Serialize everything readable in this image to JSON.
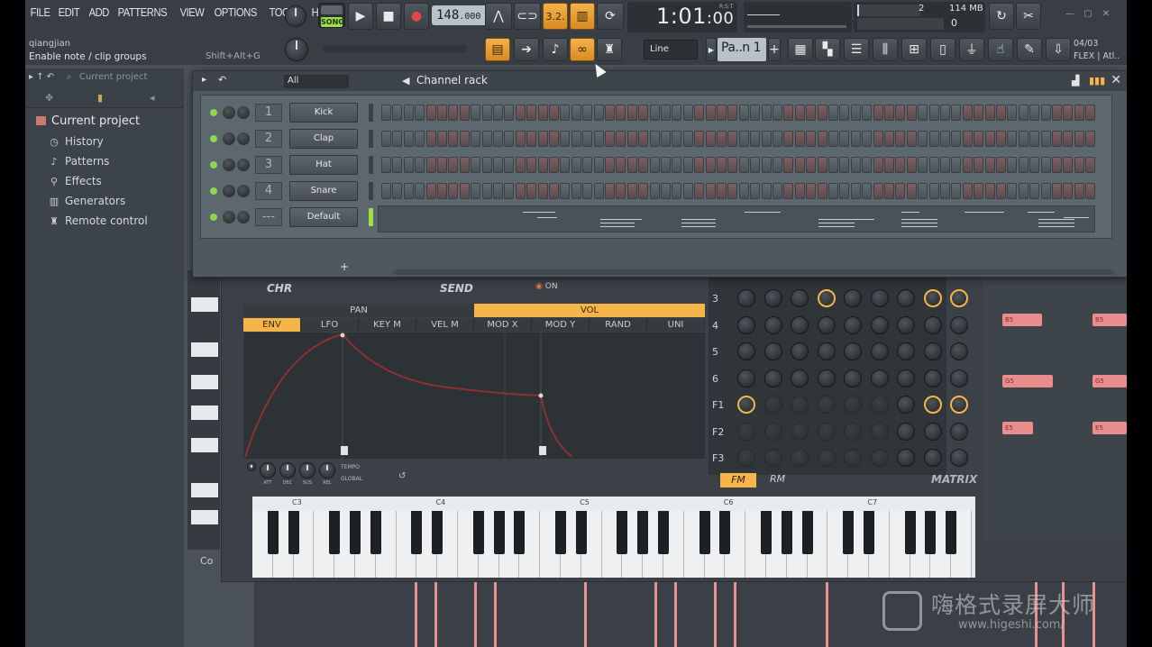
{
  "menu": {
    "items": [
      "FILE",
      "EDIT",
      "ADD",
      "PATTERNS",
      "VIEW",
      "OPTIONS",
      "TOOLS",
      "HELP"
    ]
  },
  "hint_bar": {
    "user": "qiangjian",
    "text": "Enable note / clip groups",
    "shortcut": "Shift+Alt+G"
  },
  "transport": {
    "mode": "SONG",
    "tempo_int": "148",
    "tempo_dec": ".000",
    "time_main": "1:01",
    "time_sub": ":00",
    "time_rst": "R:S:T"
  },
  "cpu": {
    "voices": "2",
    "memory": "114 MB",
    "zero": "0"
  },
  "toolbar2": {
    "snap_value": "Line",
    "pattern_value": "Pa..n 1",
    "hint_date": "04/03",
    "hint_info": "FLEX | Atl.."
  },
  "browser": {
    "path": "Current project",
    "current": "Current project",
    "items": [
      {
        "label": "History",
        "icon": "history-icon"
      },
      {
        "label": "Patterns",
        "icon": "note-icon"
      },
      {
        "label": "Effects",
        "icon": "effects-icon"
      },
      {
        "label": "Generators",
        "icon": "piano-icon"
      },
      {
        "label": "Remote control",
        "icon": "remote-icon"
      }
    ]
  },
  "channel_rack": {
    "filter": "All",
    "title": "Channel rack",
    "add_label": "+",
    "channels": [
      {
        "num": "1",
        "name": "Kick"
      },
      {
        "num": "2",
        "name": "Clap"
      },
      {
        "num": "3",
        "name": "Hat"
      },
      {
        "num": "4",
        "name": "Snare"
      },
      {
        "num": "---",
        "name": "Default"
      }
    ]
  },
  "synth": {
    "chr_label": "CHR",
    "send_label": "SEND",
    "on_label": "ON",
    "tabs_top": [
      "PAN",
      "VOL"
    ],
    "tabs_mod": [
      "ENV",
      "LFO",
      "KEY M",
      "VEL M",
      "MOD X",
      "MOD Y",
      "RAND",
      "UNI"
    ],
    "env_knobs": [
      "ATT",
      "DEC",
      "SUS",
      "REL"
    ],
    "tempo_opt": "TEMPO",
    "global_opt": "GLOBAL",
    "matrix_rows": [
      "3",
      "4",
      "5",
      "6",
      "F1",
      "F2",
      "F3"
    ],
    "fm": "FM",
    "rm": "RM",
    "matrix": "MATRIX",
    "keyboard_octaves": [
      "C3",
      "C4",
      "C5",
      "C6",
      "C7"
    ],
    "left_label": "Co"
  },
  "playlist_clips": [
    "B5",
    "B5",
    "G5",
    "G5",
    "E5",
    "E5"
  ],
  "watermark": {
    "text": "嗨格式录屏大师",
    "url": "www.higeshi.com/"
  },
  "colors": {
    "accent": "#f5b548",
    "song_green": "#9fe04a",
    "led_green": "#8ed64c",
    "clip_pink": "#e98d8c"
  }
}
